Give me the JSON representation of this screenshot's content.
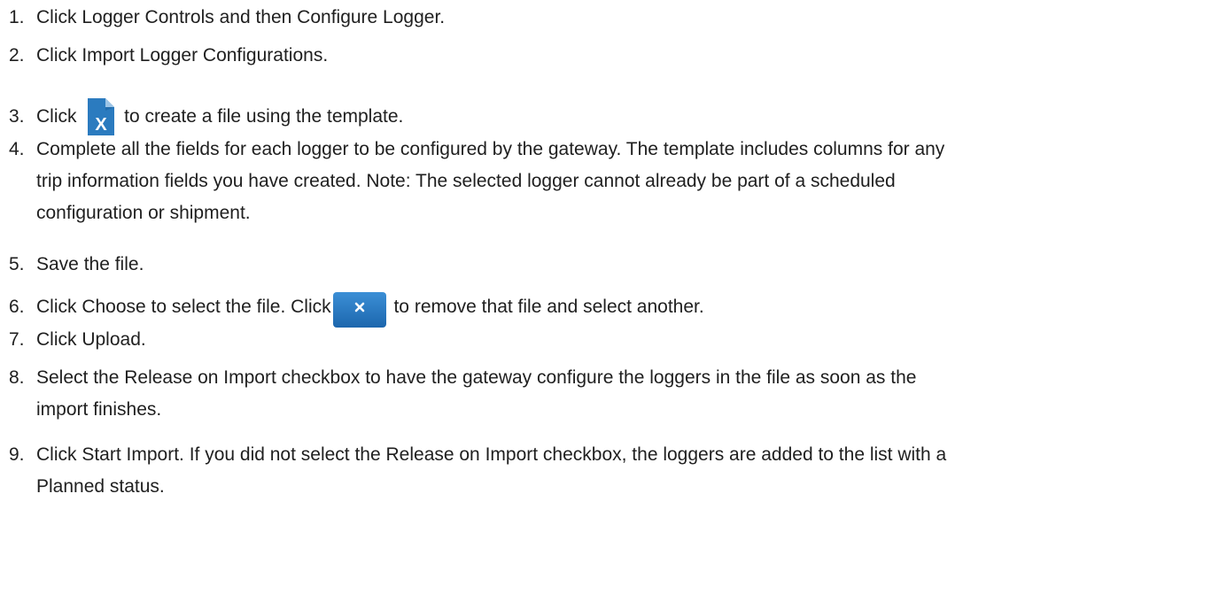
{
  "steps": [
    {
      "num": "1.",
      "text": "Click Logger Controls and then Configure Logger."
    },
    {
      "num": "2.",
      "text": "Click Import Logger Configurations."
    },
    {
      "num": "3.",
      "before": "Click ",
      "icon": "excel-file-icon",
      "after": " to create a file using the template."
    },
    {
      "num": "4.",
      "line1": "Complete all the fields for each logger to be configured by the gateway. The template includes columns for any",
      "line2": "trip information fields you have created. Note: The selected logger cannot already be part of a scheduled",
      "line3": "configuration or shipment."
    },
    {
      "num": "5.",
      "text": "Save the file."
    },
    {
      "num": "6.",
      "before": "Click Choose to select the file. Click",
      "icon": "remove-file-button-icon",
      "after": " to remove that file and select another."
    },
    {
      "num": "7.",
      "text": "Click Upload."
    },
    {
      "num": "8.",
      "line1": "Select the Release on Import checkbox to have the gateway configure the loggers in the file as soon as the",
      "line2": "import finishes."
    },
    {
      "num": "9.",
      "line1": "Click Start Import. If you did not select the Release on Import checkbox, the loggers are added to the list with a",
      "line2": "Planned status."
    }
  ],
  "colors": {
    "text": "#1f1f1f",
    "icon_blue": "#2b7bbf",
    "icon_blue_dark": "#1a5f9c"
  }
}
